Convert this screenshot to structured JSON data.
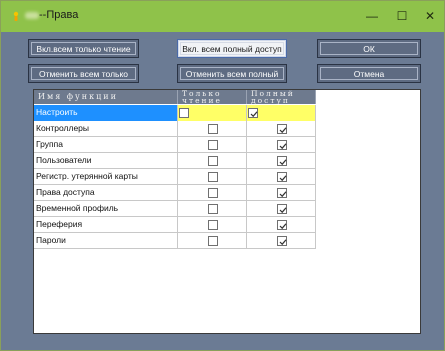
{
  "window": {
    "title": "--Права",
    "controls": {
      "minimize": "—",
      "maximize": "☐",
      "close": "✕"
    },
    "accent": "#8fc24a"
  },
  "buttons": {
    "all_read": "Вкл.всем только чтение",
    "all_full": "Вкл. всем полный доступ",
    "ok": "ОК",
    "cancel_read": "Отменить всем только",
    "cancel_full": "Отменить всем полный",
    "cancel": "Отмена"
  },
  "table": {
    "headers": {
      "name": "Имя функции",
      "read_l1": "Только",
      "read_l2": "чтение",
      "full_l1": "Полный",
      "full_l2": "доступ"
    },
    "rows": [
      {
        "name": "Настроить",
        "read_only": false,
        "full": true,
        "selected": true
      },
      {
        "name": "Контроллеры",
        "read_only": false,
        "full": true
      },
      {
        "name": "Группа",
        "read_only": false,
        "full": true
      },
      {
        "name": "Пользователи",
        "read_only": false,
        "full": true
      },
      {
        "name": "Регистр. утерянной карты",
        "read_only": false,
        "full": true
      },
      {
        "name": "Права доступа",
        "read_only": false,
        "full": true
      },
      {
        "name": "Временной профиль",
        "read_only": false,
        "full": true
      },
      {
        "name": "Переферия",
        "read_only": false,
        "full": true
      },
      {
        "name": "Пароли",
        "read_only": false,
        "full": true
      }
    ]
  }
}
